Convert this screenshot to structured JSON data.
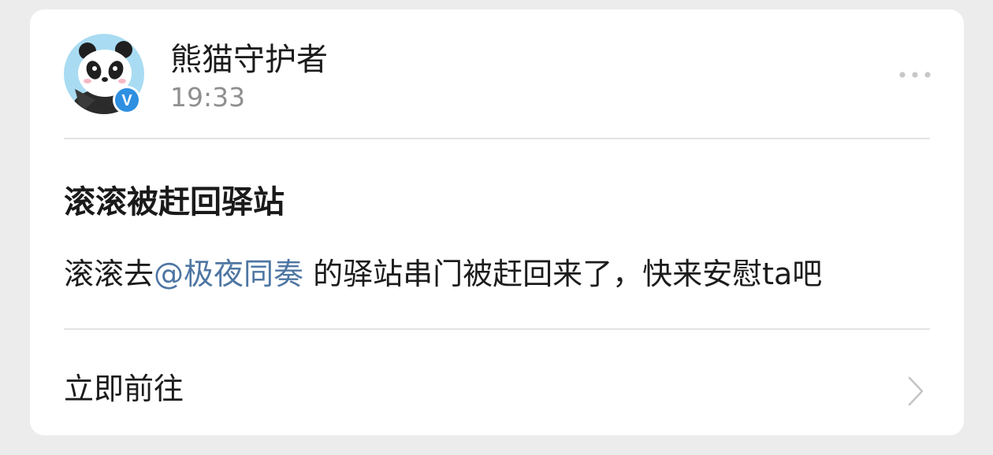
{
  "post": {
    "author": "熊猫守护者",
    "time": "19:33",
    "verified_badge": "V",
    "title": "滚滚被赶回驿站",
    "body_prefix": "滚滚去",
    "mention": "@极夜同奏",
    "body_suffix": " 的驿站串门被赶回来了，快来安慰ta吧"
  },
  "action": {
    "label": "立即前往"
  },
  "icons": {
    "more": "more-dots-icon",
    "chevron": "chevron-right-icon",
    "verified": "verified-badge-icon"
  },
  "colors": {
    "background": "#ececec",
    "card": "#ffffff",
    "mention": "#4e76a3",
    "verified_badge": "#2f8fe0",
    "avatar_bg": "#a9dcf2"
  }
}
